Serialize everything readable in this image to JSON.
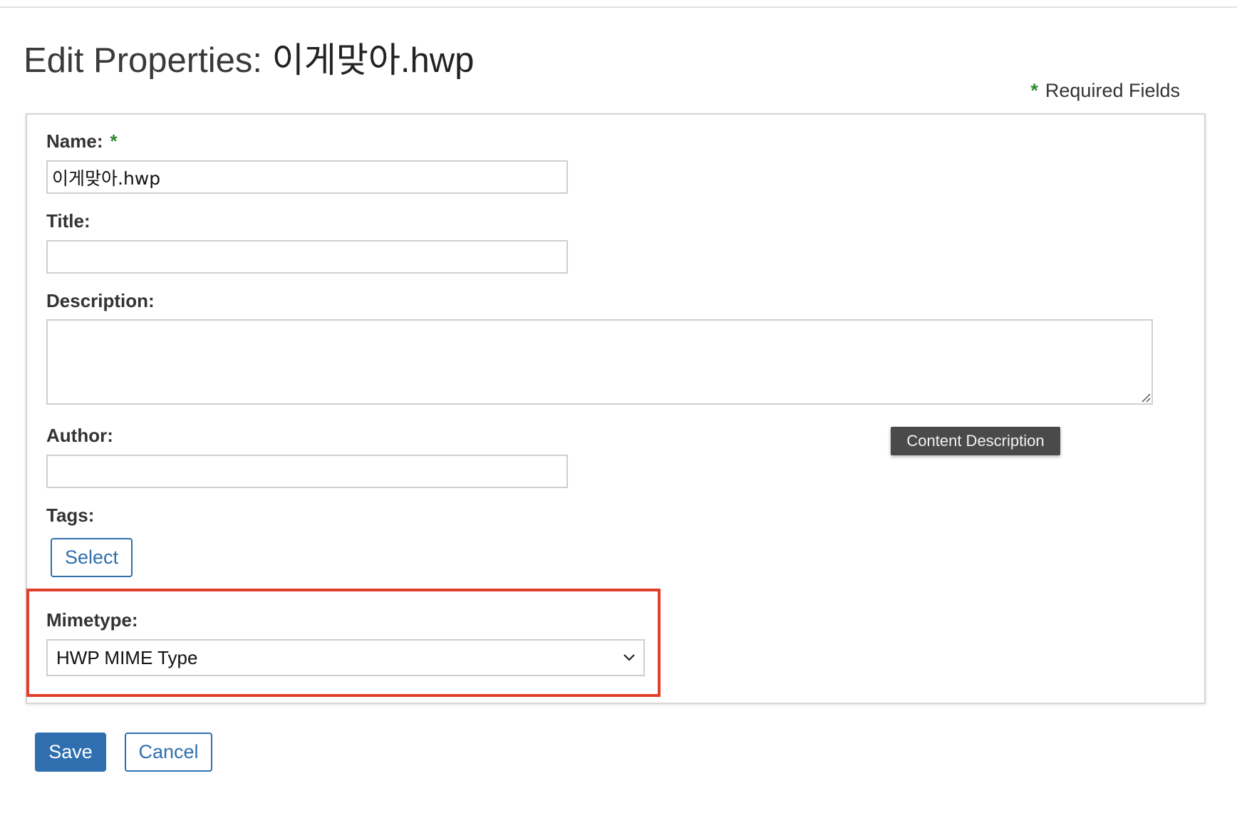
{
  "header": {
    "title_prefix": "Edit Properties: ",
    "title_filename": "이게맞아.hwp",
    "required_star": "*",
    "required_label": "Required Fields"
  },
  "form": {
    "name": {
      "label": "Name:",
      "required_star": "*",
      "value": "이게맞아.hwp"
    },
    "title": {
      "label": "Title:",
      "value": ""
    },
    "description": {
      "label": "Description:",
      "value": "",
      "tooltip": "Content Description"
    },
    "author": {
      "label": "Author:",
      "value": ""
    },
    "tags": {
      "label": "Tags:",
      "select_label": "Select"
    },
    "mimetype": {
      "label": "Mimetype:",
      "selected": "HWP MIME Type"
    }
  },
  "actions": {
    "save_label": "Save",
    "cancel_label": "Cancel"
  },
  "colors": {
    "accent": "#2f6faf",
    "required_star": "#2e8b2e",
    "highlight": "#e0402a",
    "tooltip_bg": "#4a4a4a"
  },
  "icons": [
    "chevron-down-icon",
    "resize-grip-icon"
  ]
}
